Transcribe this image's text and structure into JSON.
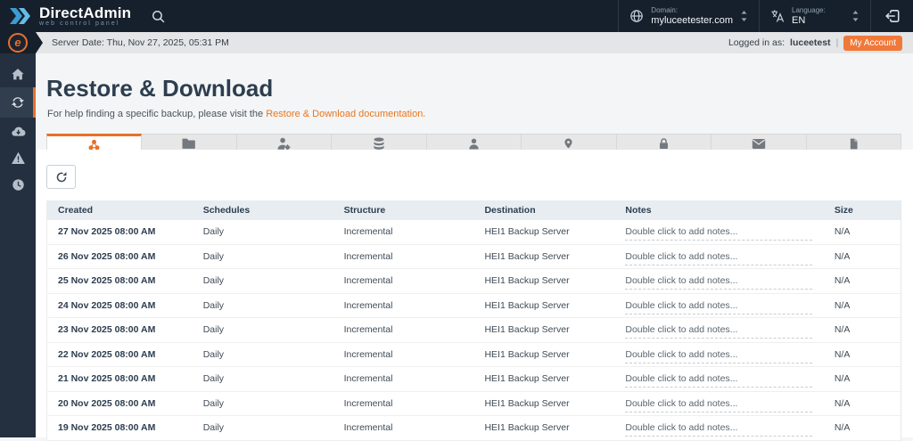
{
  "colors": {
    "accent_orange": "#e8702a",
    "nav_dark": "#16202c",
    "sidebar_dark": "#243040",
    "link_orange": "#e8761f"
  },
  "topbar": {
    "brand": {
      "title": "DirectAdmin",
      "tagline": "web control panel"
    },
    "domain": {
      "label": "Domain:",
      "value": "myluceetester.com"
    },
    "language": {
      "label": "Language:",
      "value": "EN"
    }
  },
  "statusbar": {
    "server_date": "Server Date: Thu, Nov 27, 2025, 05:31 PM",
    "logged_in_prefix": "Logged in as:",
    "username": "luceetest",
    "separator": "|",
    "my_account_label": "My Account"
  },
  "sidebar": {
    "items": [
      {
        "name": "home",
        "icon": "home",
        "active": false
      },
      {
        "name": "restore",
        "icon": "sync",
        "active": true
      },
      {
        "name": "backups",
        "icon": "cloud-download",
        "active": false
      },
      {
        "name": "alerts",
        "icon": "warning",
        "active": false
      },
      {
        "name": "history",
        "icon": "clock",
        "active": false
      }
    ]
  },
  "page": {
    "title": "Restore & Download",
    "subtitle_prefix": "For help finding a specific backup, please visit the ",
    "subtitle_link": "Restore & Download documentation."
  },
  "tabs": [
    {
      "label": "Full Account",
      "icon": "cluster",
      "active": true
    },
    {
      "label": "Home Directory",
      "icon": "folder",
      "active": false
    },
    {
      "label": "Cron Jobs",
      "icon": "user-gear",
      "active": false
    },
    {
      "label": "Databases",
      "icon": "database",
      "active": false
    },
    {
      "label": "Database Users",
      "icon": "user",
      "active": false
    },
    {
      "label": "Domains",
      "icon": "pin",
      "active": false
    },
    {
      "label": "Certificates",
      "icon": "lock",
      "active": false
    },
    {
      "label": "Email Accounts",
      "icon": "envelope",
      "active": false
    },
    {
      "label": "FTP Accounts",
      "icon": "file",
      "active": false
    }
  ],
  "table": {
    "columns": [
      "Created",
      "Schedules",
      "Structure",
      "Destination",
      "Notes",
      "Size"
    ],
    "rows": [
      {
        "created": "27 Nov 2025 08:00 AM",
        "schedules": "Daily",
        "structure": "Incremental",
        "destination": "HEI1 Backup Server",
        "notes": "Double click to add notes...",
        "size": "N/A"
      },
      {
        "created": "26 Nov 2025 08:00 AM",
        "schedules": "Daily",
        "structure": "Incremental",
        "destination": "HEI1 Backup Server",
        "notes": "Double click to add notes...",
        "size": "N/A"
      },
      {
        "created": "25 Nov 2025 08:00 AM",
        "schedules": "Daily",
        "structure": "Incremental",
        "destination": "HEI1 Backup Server",
        "notes": "Double click to add notes...",
        "size": "N/A"
      },
      {
        "created": "24 Nov 2025 08:00 AM",
        "schedules": "Daily",
        "structure": "Incremental",
        "destination": "HEI1 Backup Server",
        "notes": "Double click to add notes...",
        "size": "N/A"
      },
      {
        "created": "23 Nov 2025 08:00 AM",
        "schedules": "Daily",
        "structure": "Incremental",
        "destination": "HEI1 Backup Server",
        "notes": "Double click to add notes...",
        "size": "N/A"
      },
      {
        "created": "22 Nov 2025 08:00 AM",
        "schedules": "Daily",
        "structure": "Incremental",
        "destination": "HEI1 Backup Server",
        "notes": "Double click to add notes...",
        "size": "N/A"
      },
      {
        "created": "21 Nov 2025 08:00 AM",
        "schedules": "Daily",
        "structure": "Incremental",
        "destination": "HEI1 Backup Server",
        "notes": "Double click to add notes...",
        "size": "N/A"
      },
      {
        "created": "20 Nov 2025 08:00 AM",
        "schedules": "Daily",
        "structure": "Incremental",
        "destination": "HEI1 Backup Server",
        "notes": "Double click to add notes...",
        "size": "N/A"
      },
      {
        "created": "19 Nov 2025 08:00 AM",
        "schedules": "Daily",
        "structure": "Incremental",
        "destination": "HEI1 Backup Server",
        "notes": "Double click to add notes...",
        "size": "N/A"
      }
    ]
  }
}
